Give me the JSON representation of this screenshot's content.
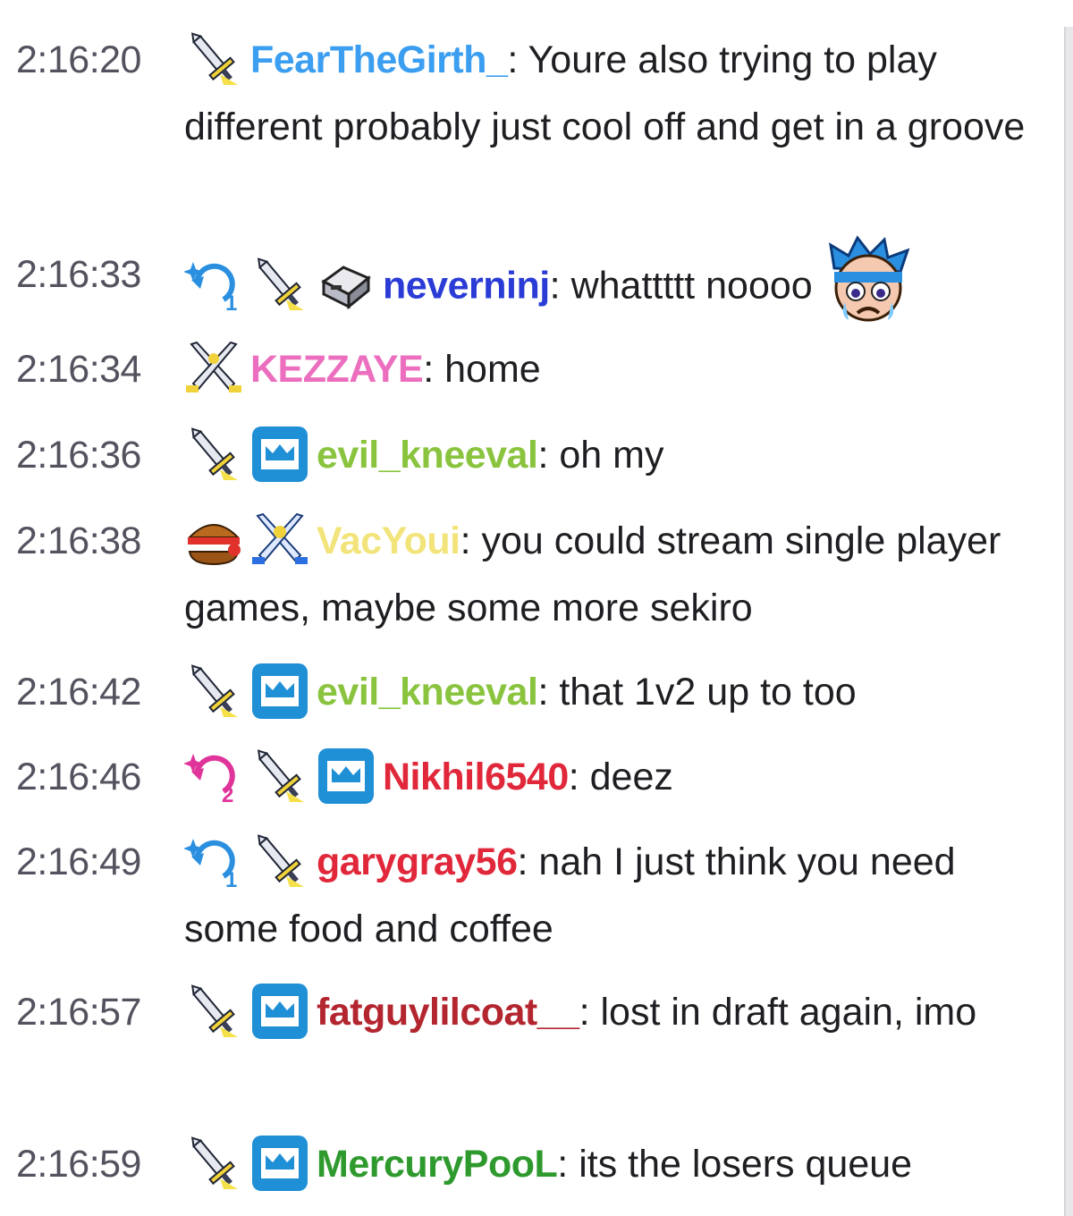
{
  "messages": [
    {
      "time": "2:16:20",
      "badges": [
        "sword"
      ],
      "user": "FearTheGirth_",
      "color": "#3b9ef0",
      "text": "Youre also trying to play different probably just cool off and get in a groove"
    },
    {
      "time": "2:16:33",
      "badges": [
        "sub-gift-1",
        "sword",
        "typewriter"
      ],
      "user": "neverninj",
      "color": "#2a3bd6",
      "text": "whattttt noooo",
      "emote": "crying-face-emote"
    },
    {
      "time": "2:16:34",
      "badges": [
        "crossed-swords"
      ],
      "user": "KEZZAYE",
      "color": "#ec6fbf",
      "text": "home"
    },
    {
      "time": "2:16:36",
      "badges": [
        "sword",
        "crown"
      ],
      "user": "evil_kneeval",
      "color": "#8ac43f",
      "text": "oh my"
    },
    {
      "time": "2:16:38",
      "badges": [
        "burger",
        "crossed-swords-blue"
      ],
      "user": "VacYoui",
      "color": "#f2e47a",
      "text": "you could stream single player games, maybe some more sekiro"
    },
    {
      "time": "2:16:42",
      "badges": [
        "sword",
        "crown"
      ],
      "user": "evil_kneeval",
      "color": "#8ac43f",
      "text": "that 1v2 up to too"
    },
    {
      "time": "2:16:46",
      "badges": [
        "sub-gift-2",
        "sword",
        "crown"
      ],
      "user": "Nikhil6540",
      "color": "#e0283a",
      "text": "deez"
    },
    {
      "time": "2:16:49",
      "badges": [
        "sub-gift-1",
        "sword"
      ],
      "user": "garygray56",
      "color": "#e0283a",
      "text": "nah I just think you need some food and coffee"
    },
    {
      "time": "2:16:57",
      "badges": [
        "sword",
        "crown"
      ],
      "user": "fatguylilcoat__",
      "color": "#b3262f",
      "text": "lost in draft again, imo"
    },
    {
      "time": "2:16:59",
      "badges": [
        "sword",
        "crown"
      ],
      "user": "MercuryPooL",
      "color": "#2e9a2e",
      "text": "its the losers queue"
    }
  ]
}
